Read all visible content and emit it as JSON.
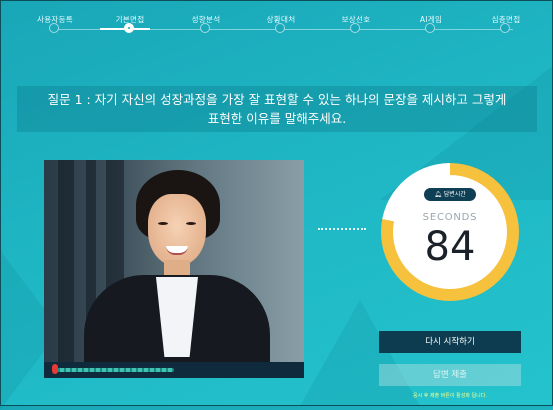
{
  "steps": [
    {
      "label": "사용자등록",
      "active": false
    },
    {
      "label": "기본면접",
      "active": true
    },
    {
      "label": "성향분석",
      "active": false
    },
    {
      "label": "상황대처",
      "active": false
    },
    {
      "label": "보상선호",
      "active": false
    },
    {
      "label": "AI게임",
      "active": false
    },
    {
      "label": "심층면접",
      "active": false
    }
  ],
  "question": {
    "line1": "질문 1 : 자기 자신의 성장과정을 가장 잘 표현할 수 있는 하나의 문장을 제시하고 그렇게",
    "line2": "표현한 이유를 말해주세요."
  },
  "timer": {
    "badge": "답변시간",
    "caption": "SECONDS",
    "value": "84"
  },
  "buttons": {
    "restart": "다시 시작하기",
    "submit": "답변 제출"
  },
  "note": "응시 후 제출 버튼이 활성화 됩니다.",
  "colors": {
    "background": "#1fb6c4",
    "timer_ring": "#f6c13d",
    "button_dark": "#0d3c51",
    "note": "#f8ff8a"
  }
}
